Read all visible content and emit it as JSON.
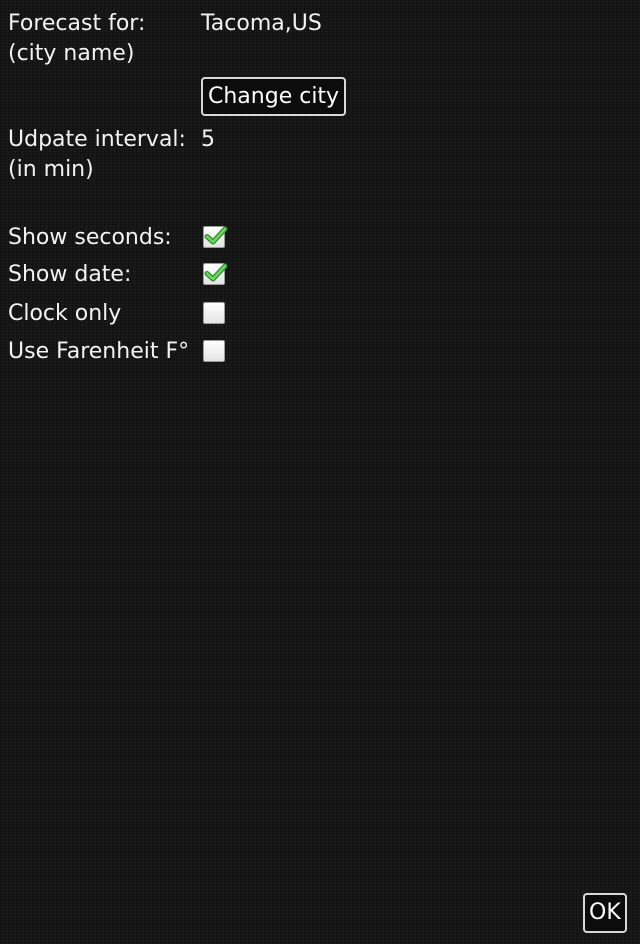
{
  "forecast": {
    "label_line1": "Forecast for:",
    "label_line2": "(city name)",
    "city": "Tacoma,US",
    "change_button_label": "Change city"
  },
  "update_interval": {
    "label_line1": "Udpate interval:",
    "label_line2": "(in min)",
    "value": "5"
  },
  "options": [
    {
      "label": "Show seconds:",
      "checked": true
    },
    {
      "label": "Show date:",
      "checked": true
    },
    {
      "label": "Clock only",
      "checked": false
    },
    {
      "label": "Use Farenheit F°",
      "checked": false
    }
  ],
  "ok_button_label": "OK",
  "colors": {
    "background": "#161616",
    "text": "#f2f2f2",
    "check_green": "#3fb83a"
  },
  "icons": {
    "checkbox_checked": "check-mark-icon"
  }
}
